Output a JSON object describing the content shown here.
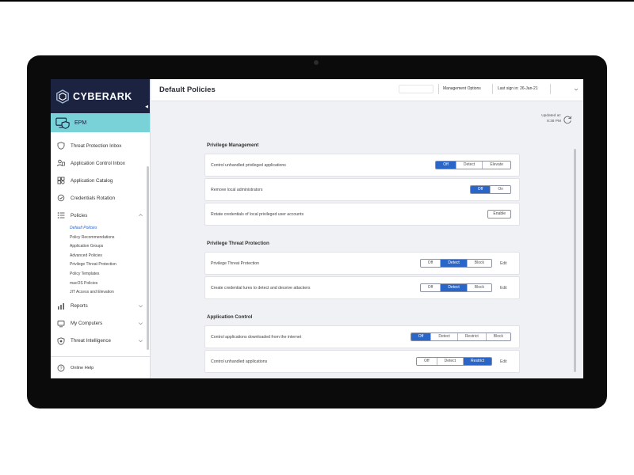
{
  "brand": {
    "name": "CYBERARK"
  },
  "product": {
    "label": "EPM"
  },
  "nav": {
    "items": [
      {
        "label": "Threat Protection Inbox"
      },
      {
        "label": "Application Control Inbox"
      },
      {
        "label": "Application Catalog"
      },
      {
        "label": "Credentials Rotation"
      },
      {
        "label": "Policies"
      }
    ],
    "policies_sub": [
      {
        "label": "Default Policies"
      },
      {
        "label": "Policy Recommendations"
      },
      {
        "label": "Application Groups"
      },
      {
        "label": "Advanced Policies"
      },
      {
        "label": "Privilege Threat Protection"
      },
      {
        "label": "Policy Templates"
      },
      {
        "label": "macOS Policies"
      },
      {
        "label": "JIT Access and Elevation"
      }
    ],
    "bottom_items": [
      {
        "label": "Reports"
      },
      {
        "label": "My Computers"
      },
      {
        "label": "Threat Intelligence"
      }
    ],
    "help": {
      "label": "Online Help"
    }
  },
  "header": {
    "title": "Default Policies",
    "management_options": "Management Options",
    "last_sign_in": "Last sign in: 26-Jan-21"
  },
  "updated": {
    "label": "Updated at:",
    "time": "8:38 PM"
  },
  "sections": {
    "privilege_management": {
      "title": "Privilege Management",
      "rows": [
        {
          "label": "Control unhandled privileged applications",
          "options": [
            "Off",
            "Detect",
            "Elevate"
          ],
          "selected": "Off"
        },
        {
          "label": "Remove local administrators",
          "options": [
            "Off",
            "On"
          ],
          "selected": "Off"
        },
        {
          "label": "Rotate credentials of local privileged user accounts",
          "button": "Enable"
        }
      ]
    },
    "privilege_threat_protection": {
      "title": "Privilege Threat Protection",
      "rows": [
        {
          "label": "Privilege Threat Protection",
          "options": [
            "Off",
            "Detect",
            "Block"
          ],
          "selected": "Detect",
          "edit": "Edit"
        },
        {
          "label": "Create credential lures to detect and deceive attackers",
          "options": [
            "Off",
            "Detect",
            "Block"
          ],
          "selected": "Detect",
          "edit": "Edit"
        }
      ]
    },
    "application_control": {
      "title": "Application Control",
      "rows": [
        {
          "label": "Control applications downloaded from the internet",
          "options": [
            "Off",
            "Detect",
            "Restrict",
            "Block"
          ],
          "selected": "Off"
        },
        {
          "label": "Control unhandled applications",
          "options": [
            "Off",
            "Detect",
            "Restrict"
          ],
          "selected": "Restrict",
          "edit": "Edit"
        }
      ]
    }
  },
  "colors": {
    "accent": "#2a66c8",
    "brand_bg": "#1b2340",
    "product_bg": "#79d2d8"
  }
}
